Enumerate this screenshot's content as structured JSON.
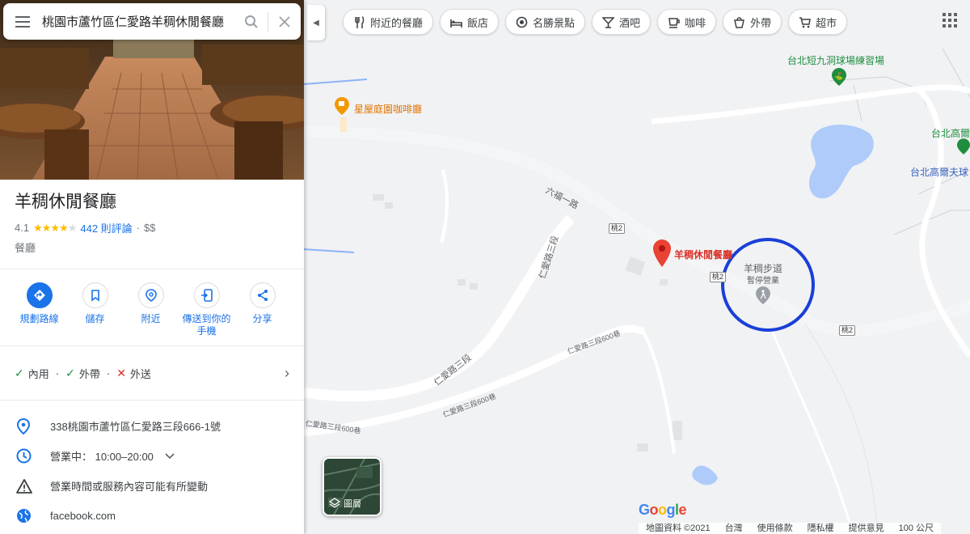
{
  "search": {
    "value": "桃園市蘆竹區仁愛路羊稠休閒餐廳"
  },
  "place": {
    "title": "羊稠休閒餐廳",
    "rating": "4.1",
    "stars": 4,
    "reviews": "442 則評論",
    "price": "$$",
    "category": "餐廳"
  },
  "actions": [
    {
      "label": "規劃路線",
      "icon": "directions-icon"
    },
    {
      "label": "儲存",
      "icon": "bookmark-icon"
    },
    {
      "label": "附近",
      "icon": "nearby-icon"
    },
    {
      "label": "傳送到你的手機",
      "icon": "send-to-phone-icon"
    },
    {
      "label": "分享",
      "icon": "share-icon"
    }
  ],
  "services": [
    {
      "label": "內用",
      "available": true
    },
    {
      "label": "外帶",
      "available": true
    },
    {
      "label": "外送",
      "available": false
    }
  ],
  "info": {
    "address": "338桃園市蘆竹區仁愛路三段666-1號",
    "hours": "營業中： 10:00–20:00",
    "notice": "營業時間或服務內容可能有所變動",
    "website": "facebook.com"
  },
  "chips": [
    {
      "label": "附近的餐廳",
      "icon": "fork-knife-icon"
    },
    {
      "label": "飯店",
      "icon": "bed-icon"
    },
    {
      "label": "名勝景點",
      "icon": "camera-icon"
    },
    {
      "label": "酒吧",
      "icon": "cocktail-icon"
    },
    {
      "label": "咖啡",
      "icon": "coffee-icon"
    },
    {
      "label": "外帶",
      "icon": "takeout-icon"
    },
    {
      "label": "超市",
      "icon": "cart-icon"
    }
  ],
  "map": {
    "poi_golf_range": "台北短九洞球場練習場",
    "poi_cafe": "星屋庭園咖啡廳",
    "poi_golf_a": "台北高爾",
    "poi_golf_b": "台北高爾夫球",
    "road_liufu": "六福一路",
    "road_renai_3": "仁愛路三段",
    "road_renai_3_b": "仁愛路三段",
    "road_lane600_a": "仁愛路三段600巷",
    "road_lane600_b": "仁愛路三段600巷",
    "road_lane600_c": "仁愛路三段600巷",
    "route_a": "桃2",
    "route_b": "桃2",
    "route_c": "桃2",
    "route_d": "桃2",
    "pin_label": "羊稠休閒餐廳",
    "trail_name": "羊稠步道",
    "trail_status": "暫停營業",
    "layers_label": "圖層",
    "google": "Google",
    "footer": [
      "地圖資料 ©2021",
      "台灣",
      "使用條款",
      "隱私權",
      "提供意見",
      "100 公尺"
    ],
    "colors": {
      "pin": "#ea4335",
      "highlight_circle": "#1a3fd8",
      "poi_green": "#1e8e3e",
      "poi_orange": "#e37400"
    }
  }
}
